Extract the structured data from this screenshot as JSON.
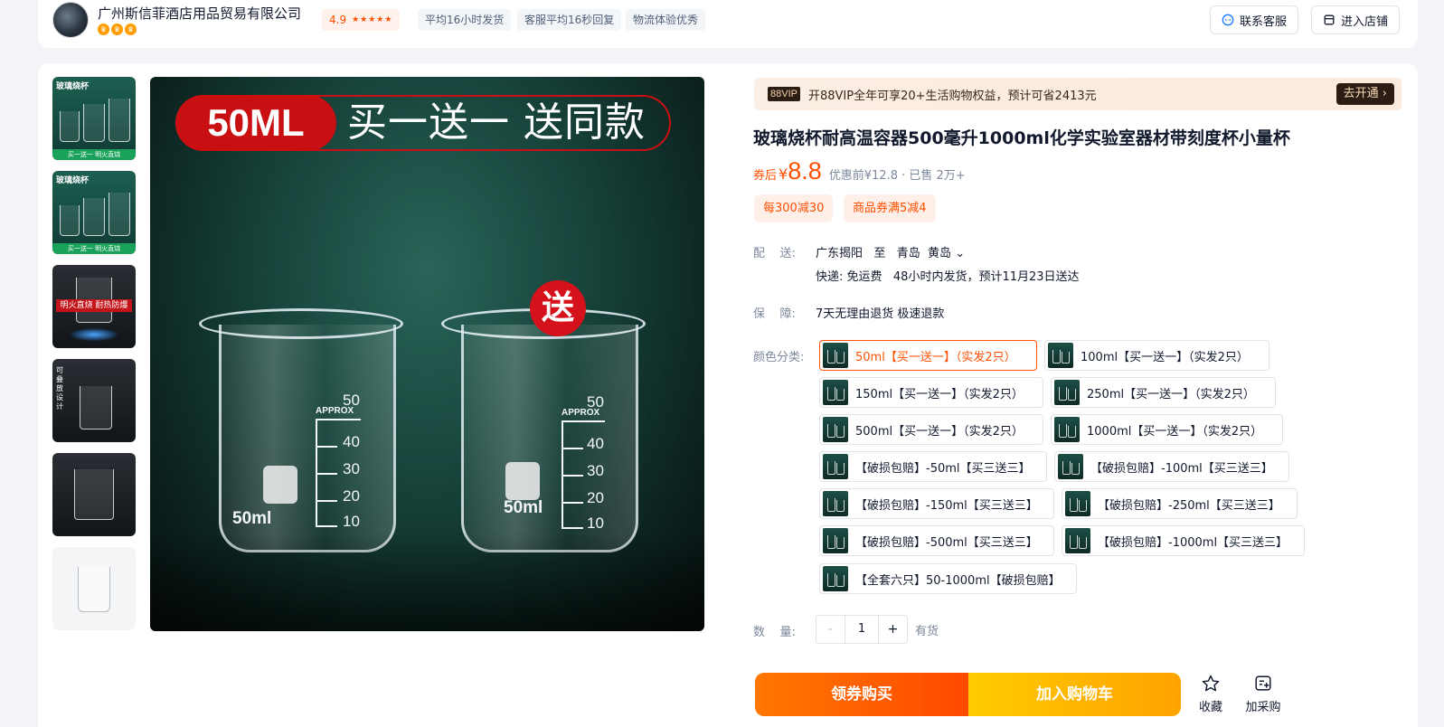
{
  "shop": {
    "name": "广州斯信菲酒店用品贸易有限公司",
    "rating": "4.9",
    "stars": "★★★★★",
    "tags": [
      "平均16小时发货",
      "客服平均16秒回复",
      "物流体验优秀"
    ],
    "contact_label": "联系客服",
    "enter_label": "进入店铺"
  },
  "gallery": {
    "thumb_caption": "玻璃烧杯",
    "thumb_strip": "买一送一 明火直烧",
    "thumb3_caption": "明火直烧 耐热防爆",
    "thumb4_caption": "可叠放设计",
    "hero_size": "50ML",
    "hero_promo": "买一送一 送同款",
    "gift_badge": "送",
    "beaker_brand": "APPROX",
    "beaker_volume": "50ml",
    "scale": [
      "50",
      "40",
      "30",
      "20",
      "10"
    ]
  },
  "vip": {
    "badge": "88VIP",
    "text": "开88VIP全年可享20+生活购物权益，预计可省2413元",
    "button": "去开通 ›"
  },
  "product": {
    "title": "玻璃烧杯耐高温容器500毫升1000ml化学实验室器材带刻度杯小量杯",
    "price_prefix": "券后",
    "currency": "¥",
    "price": "8.8",
    "price_meta": "优惠前¥12.8 · 已售 2万+",
    "coupons": [
      "每300减30",
      "商品券满5减4"
    ]
  },
  "delivery": {
    "label": "配    送:",
    "route": "广东揭阳   至   青岛  黄岛 ⌄",
    "detail": "快递: 免运费   48小时内发货，预计11月23日送达"
  },
  "guarantee": {
    "label": "保    障:",
    "text": "7天无理由退货 极速退款"
  },
  "sku": {
    "label": "颜色分类:",
    "options": [
      "50ml【买一送一】（实发2只）",
      "100ml【买一送一】（实发2只）",
      "150ml【买一送一】（实发2只）",
      "250ml【买一送一】（实发2只）",
      "500ml【买一送一】（实发2只）",
      "1000ml【买一送一】（实发2只）",
      "【破损包赔】-50ml【买三送三】",
      "【破损包赔】-100ml【买三送三】",
      "【破损包赔】-150ml【买三送三】",
      "【破损包赔】-250ml【买三送三】",
      "【破损包赔】-500ml【买三送三】",
      "【破损包赔】-1000ml【买三送三】",
      "【全套六只】50-1000ml【破损包赔】"
    ],
    "selected": "50ml【买一送一】（实发2只）"
  },
  "quantity": {
    "label": "数    量:",
    "minus": "-",
    "value": "1",
    "plus": "+",
    "stock": "有货"
  },
  "actions": {
    "buy": "领券购买",
    "cart": "加入购物车",
    "favorite": "收藏",
    "purchase_list": "加采购"
  },
  "icons": {
    "contact": "chat-bubble-icon",
    "shop": "store-icon",
    "favorite": "star-outline-icon",
    "purchase_list": "list-add-icon"
  },
  "colors": {
    "accent": "#ff5000",
    "buy_gradient": [
      "#ff7700",
      "#ff4900"
    ],
    "cart_gradient": [
      "#ffcb00",
      "#ffa200"
    ],
    "vip_dark": "#2c1d14"
  }
}
